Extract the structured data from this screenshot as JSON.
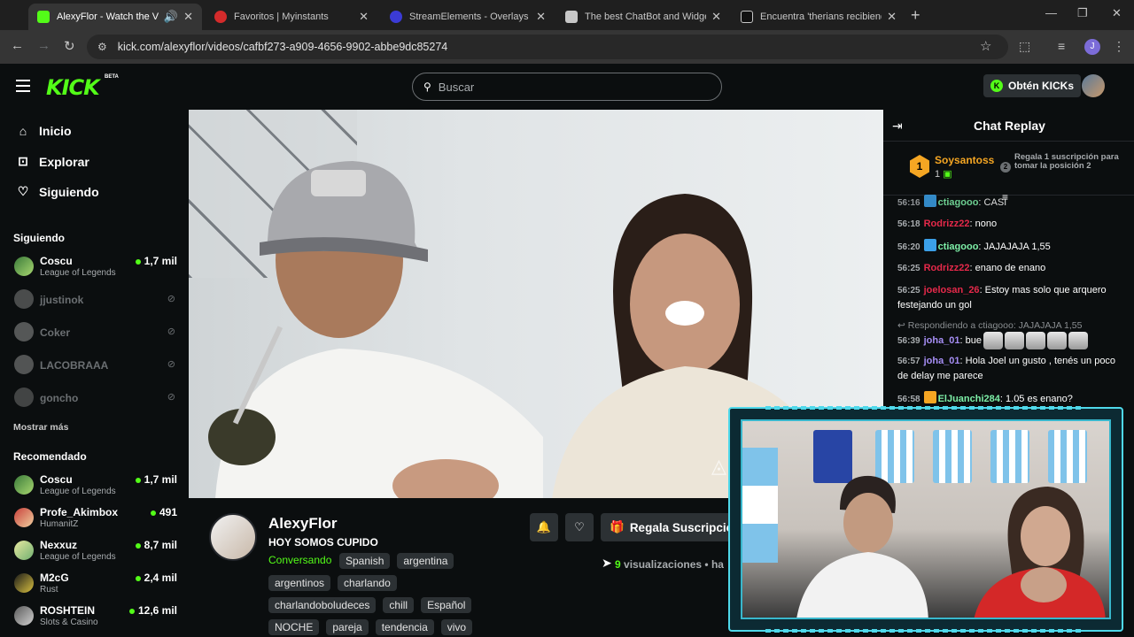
{
  "browser": {
    "tabs": [
      {
        "title": "AlexyFlor - Watch the VOD",
        "active": true,
        "favicon_color": "#53fc18"
      },
      {
        "title": "Favoritos | Myinstants",
        "active": false,
        "favicon_color": "#d42b2b"
      },
      {
        "title": "StreamElements - Overlays",
        "active": false,
        "favicon_color": "#3b3bd6"
      },
      {
        "title": "The best ChatBot and Widgets",
        "active": false,
        "favicon_color": "#c7c7c7"
      },
      {
        "title": "Encuentra 'therians recibiendo",
        "active": false,
        "favicon_color": "#111111"
      }
    ],
    "url": "kick.com/alexyflor/videos/cafbf273-a909-4656-9902-abbe9dc85274",
    "profile_initial": "J"
  },
  "header": {
    "logo": "KICK",
    "beta": "BETA",
    "search_placeholder": "Buscar",
    "kicks_label": "Obtén KICKs"
  },
  "sidebar": {
    "nav": [
      {
        "label": "Inicio",
        "icon": "home-icon"
      },
      {
        "label": "Explorar",
        "icon": "compass-icon"
      },
      {
        "label": "Siguiendo",
        "icon": "heart-icon"
      }
    ],
    "following_title": "Siguiendo",
    "following": [
      {
        "name": "Coscu",
        "game": "League of Legends",
        "viewers": "1,7 mil",
        "live": true
      },
      {
        "name": "jjustinok",
        "live": false
      },
      {
        "name": "Coker",
        "live": false
      },
      {
        "name": "LACOBRAAA",
        "live": false
      },
      {
        "name": "goncho",
        "live": false
      }
    ],
    "show_more": "Mostrar más",
    "recommended_title": "Recomendado",
    "recommended": [
      {
        "name": "Coscu",
        "game": "League of Legends",
        "viewers": "1,7 mil"
      },
      {
        "name": "Profe_Akimbox",
        "game": "HumanitZ",
        "viewers": "491"
      },
      {
        "name": "Nexxuz",
        "game": "League of Legends",
        "viewers": "8,7 mil"
      },
      {
        "name": "M2cG",
        "game": "Rust",
        "viewers": "2,4 mil"
      },
      {
        "name": "ROSHTEIN",
        "game": "Slots & Casino",
        "viewers": "12,6 mil"
      }
    ]
  },
  "stream": {
    "channel": "AlexyFlor",
    "title": "HOY SOMOS CUPIDO",
    "category": "Conversando",
    "tags_row1": [
      "Spanish",
      "argentina"
    ],
    "tags_row2": [
      "argentinos",
      "charlando"
    ],
    "tags_row3": [
      "charlandoboludeces",
      "chill",
      "Español"
    ],
    "tags_row4": [
      "NOCHE",
      "pareja",
      "tendencia",
      "vivo"
    ],
    "gift_label": "Regala Suscripcio",
    "views_count": "9",
    "views_label": "visualizaciones",
    "views_suffix": "• ha"
  },
  "chat": {
    "title": "Chat Replay",
    "top_gifter": {
      "rank": "1",
      "name": "Soysantoss",
      "count": "1"
    },
    "slot2_text": "Regala 1 suscripción para tomar la posición 2",
    "slot2_rank": "2",
    "messages": [
      {
        "time": "56:18",
        "user": "Rodrizz22",
        "color": "#e5294a",
        "text": ": nono"
      },
      {
        "time": "56:20",
        "user": "ctiagooo",
        "color": "#7ef0a8",
        "text": ": JAJAJAJA 1,55"
      },
      {
        "time": "56:25",
        "user": "Rodrizz22",
        "color": "#e5294a",
        "text": ": enano de enano"
      },
      {
        "time": "56:25",
        "user": "joelosan_26",
        "color": "#e5294a",
        "text": ": Estoy mas solo que arquero festejando un gol"
      },
      {
        "time": "56:39",
        "user": "joha_01",
        "color": "#a68ef5",
        "text": ": bue"
      },
      {
        "time": "56:57",
        "user": "joha_01",
        "color": "#a68ef5",
        "text": ": Hola Joel un gusto , tenés un poco de delay me parece"
      },
      {
        "time": "56:58",
        "user": "ElJuanchi284",
        "color": "#7ef0a8",
        "text": ": 1.05 es enano?"
      }
    ],
    "partial_top": {
      "time": "56:16",
      "user": "ctiagooo",
      "text": ": CASI"
    },
    "reply_note": "Respondiendo a ctiagooo: JAJAJAJA 1,55"
  }
}
